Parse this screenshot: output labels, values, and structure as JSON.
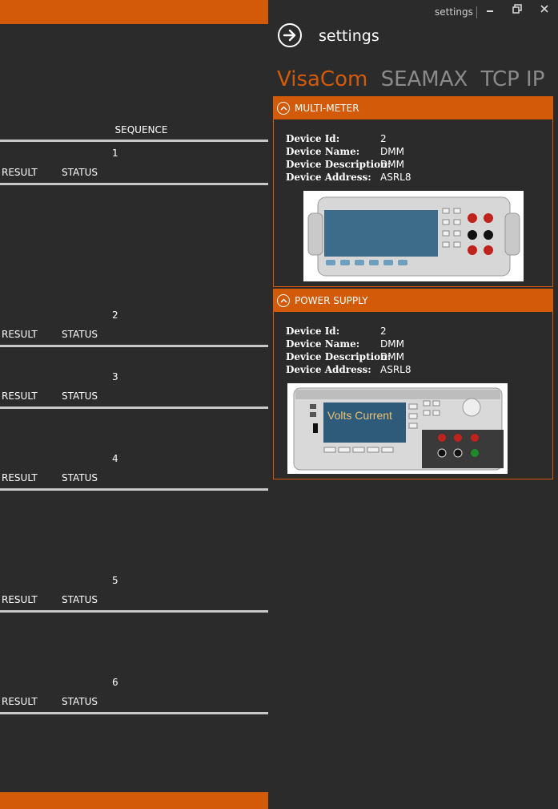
{
  "left": {
    "sequence_header": "SEQUENCE",
    "steps": [
      {
        "num": "1",
        "result": "RESULT",
        "status": "STATUS"
      },
      {
        "num": "2",
        "result": "RESULT",
        "status": "STATUS"
      },
      {
        "num": "3",
        "result": "RESULT",
        "status": "STATUS"
      },
      {
        "num": "4",
        "result": "RESULT",
        "status": "STATUS"
      },
      {
        "num": "5",
        "result": "RESULT",
        "status": "STATUS"
      },
      {
        "num": "6",
        "result": "RESULT",
        "status": "STATUS"
      }
    ]
  },
  "window": {
    "title": "settings",
    "minimize": "minimize-icon",
    "restore": "restore-icon",
    "close": "close-icon"
  },
  "settings": {
    "title": "settings",
    "tabs": [
      "VisaCom",
      "SEAMAX",
      "TCP IP"
    ],
    "active_tab": "VisaCom"
  },
  "panels": [
    {
      "header": "MULTI-METER",
      "labels": [
        "Device Id:",
        "Device Name:",
        "Device Description:",
        "Device Address:"
      ],
      "values": [
        "2",
        "DMM",
        "DMM",
        "ASRL8"
      ]
    },
    {
      "header": "POWER SUPPLY",
      "labels": [
        "Device Id:",
        "Device Name:",
        "Device Description:",
        "Device Address:"
      ],
      "values": [
        "2",
        "DMM",
        "DMM",
        "ASRL8"
      ],
      "screen_text": "Volts  Current"
    }
  ],
  "colors": {
    "accent": "#d35a09",
    "background": "#2b2b2b",
    "divider": "#c8c8c8"
  }
}
